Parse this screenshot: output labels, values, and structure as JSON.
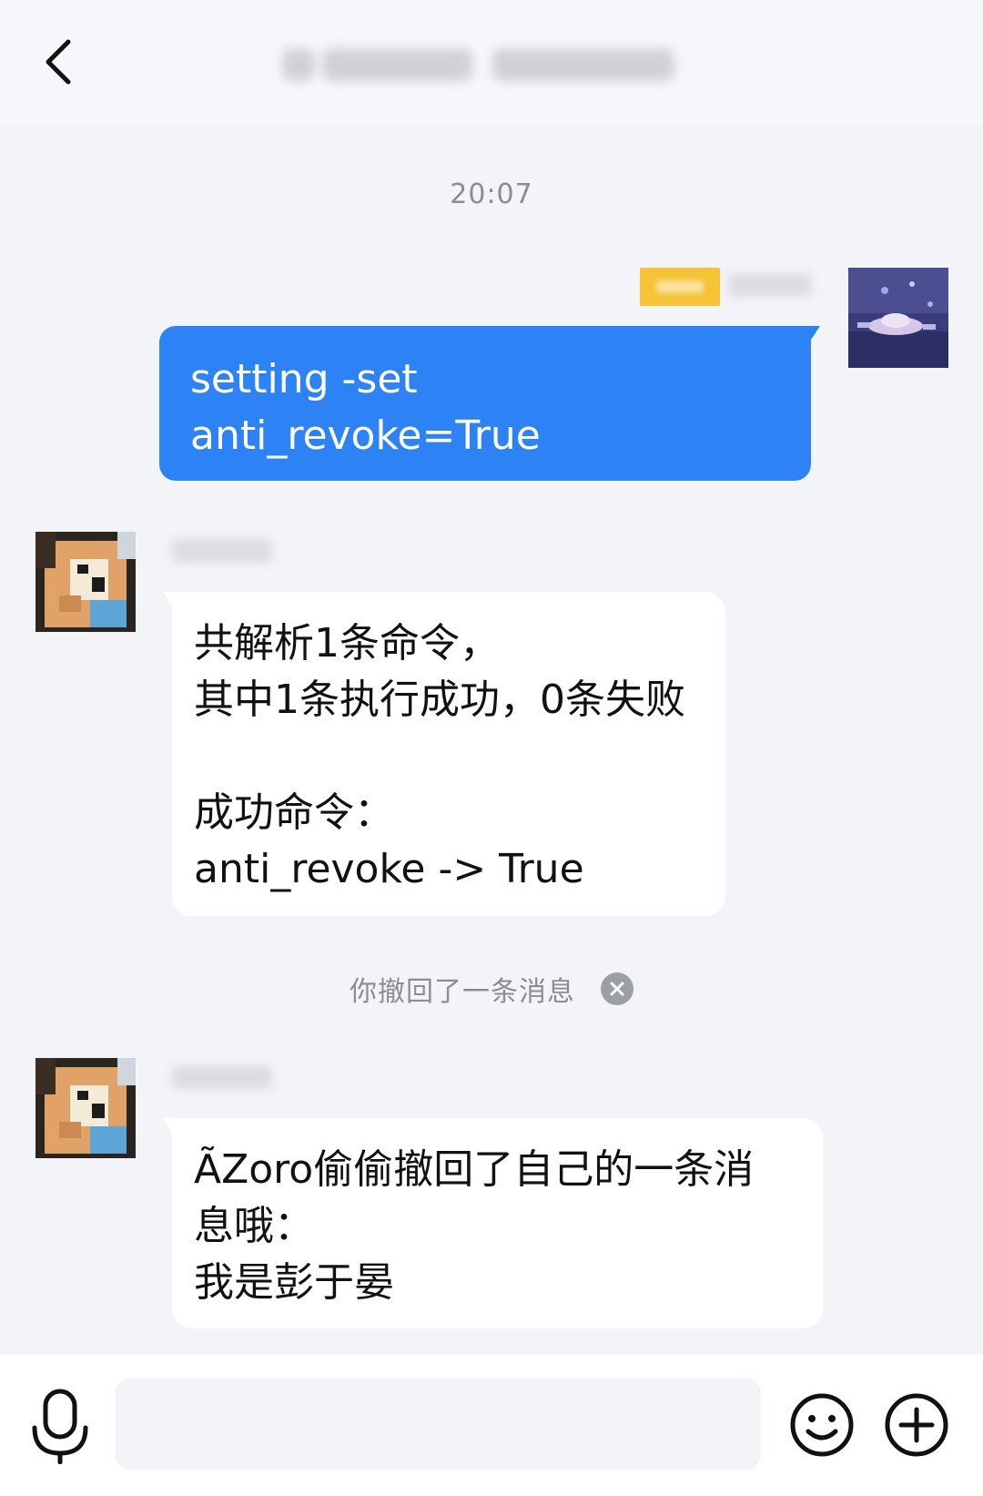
{
  "header": {
    "title": "",
    "back_icon": "chevron-left-icon"
  },
  "chat": {
    "timestamp": "20:07",
    "outgoing": {
      "sender_name": "",
      "sender_badge": "",
      "lines": [
        "setting -set",
        "anti_revoke=True"
      ]
    },
    "reply1": {
      "sender_name": "",
      "lines": [
        "共解析1条命令，",
        "其中1条执行成功，0条失败",
        "",
        "成功命令：",
        "anti_revoke -> True"
      ]
    },
    "system_notice": {
      "text": "你撤回了一条消息",
      "close_icon": "close-circle-icon"
    },
    "reply2": {
      "sender_name": "",
      "lines": [
        "ÃZoro偷偷撤回了自己的一条消",
        "息哦：",
        "我是彭于晏"
      ]
    }
  },
  "input_bar": {
    "value": "",
    "placeholder": "",
    "voice_icon": "microphone-icon",
    "emoji_icon": "smiley-icon",
    "more_icon": "plus-circle-icon"
  },
  "colors": {
    "accent": "#2d83f6",
    "background": "#f3f4f8",
    "badge": "#f6c335"
  }
}
